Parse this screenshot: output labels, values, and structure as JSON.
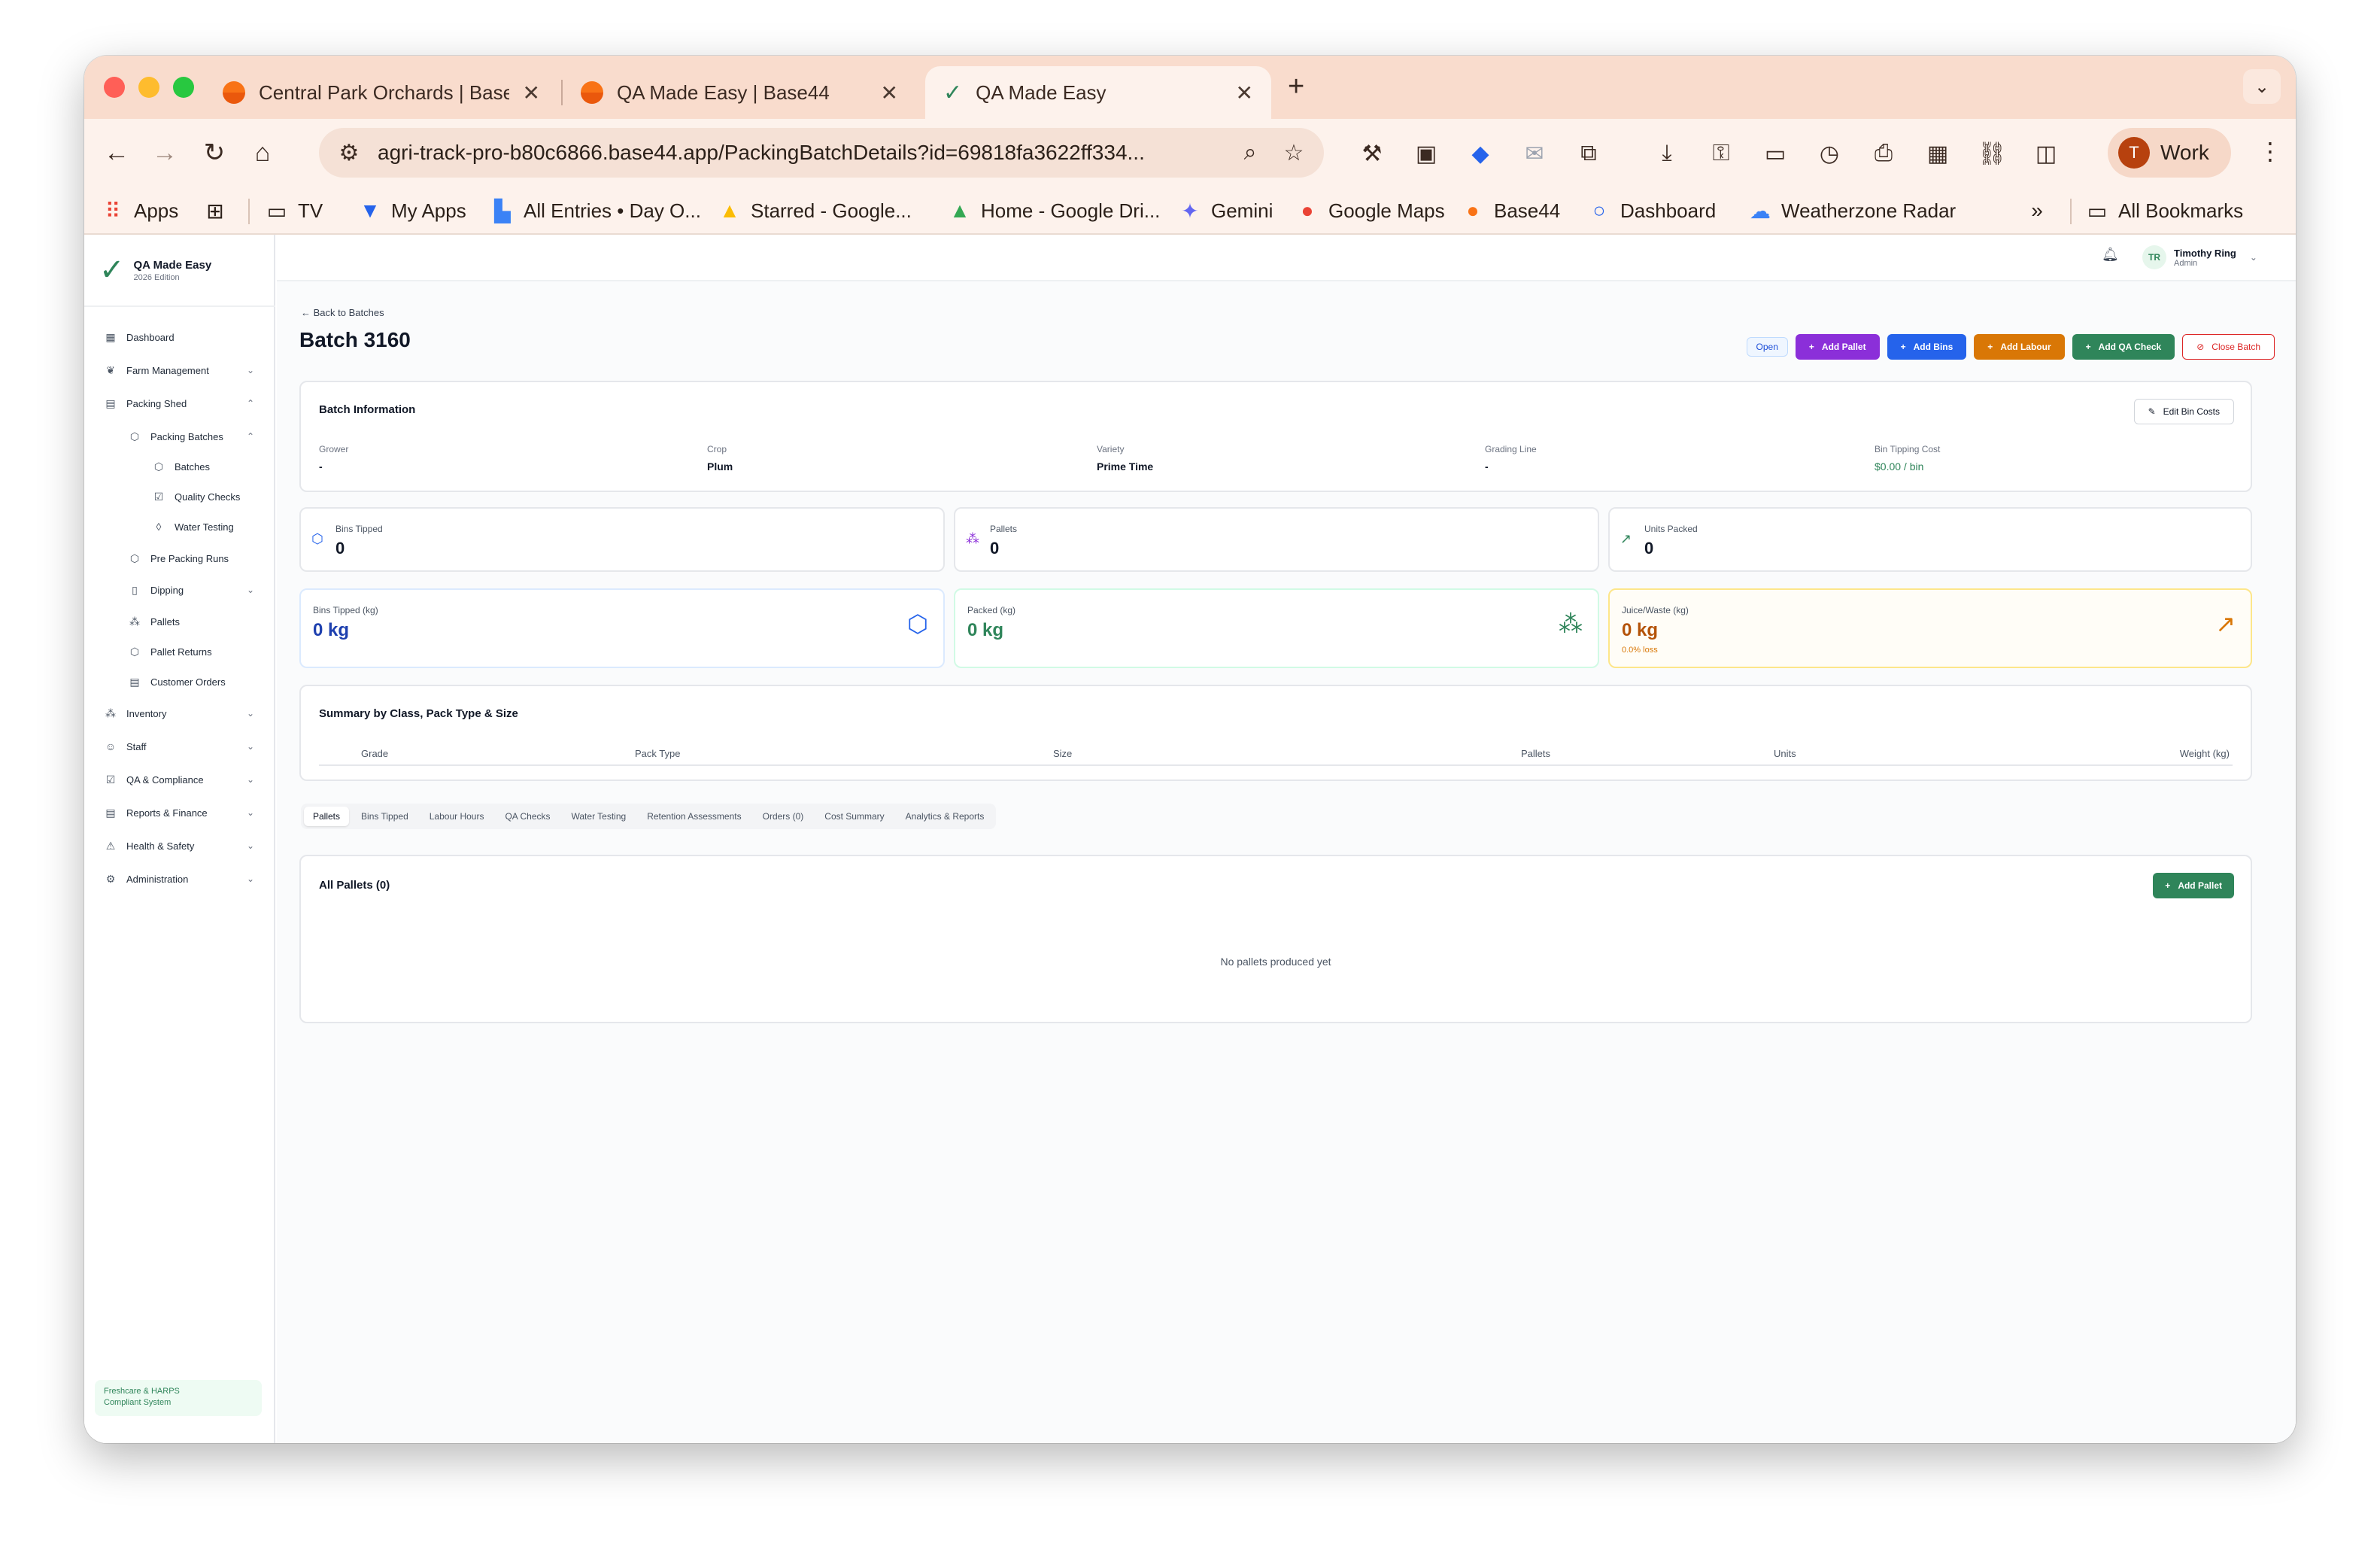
{
  "browser": {
    "tabs": [
      {
        "title": "Central Park Orchards | Base44"
      },
      {
        "title": "QA Made Easy | Base44"
      },
      {
        "title": "QA Made Easy"
      }
    ],
    "url": "agri-track-pro-b80c6866.base44.app/PackingBatchDetails?id=69818fa3622ff334...",
    "profile_initial": "T",
    "profile_label": "Work",
    "bookmarks": [
      {
        "label": "Apps"
      },
      {
        "label": "TV"
      },
      {
        "label": "My Apps"
      },
      {
        "label": "All Entries • Day O..."
      },
      {
        "label": "Starred - Google..."
      },
      {
        "label": "Home - Google Dri..."
      },
      {
        "label": "Gemini"
      },
      {
        "label": "Google Maps"
      },
      {
        "label": "Base44"
      },
      {
        "label": "Dashboard"
      },
      {
        "label": "Weatherzone Radar"
      },
      {
        "label": "All Bookmarks"
      }
    ]
  },
  "brand": {
    "name": "QA Made Easy",
    "edition": "2026 Edition"
  },
  "sidebar": {
    "items": [
      {
        "label": "Dashboard"
      },
      {
        "label": "Farm Management"
      },
      {
        "label": "Packing Shed"
      },
      {
        "label": "Packing Batches"
      },
      {
        "label": "Batches"
      },
      {
        "label": "Quality Checks"
      },
      {
        "label": "Water Testing"
      },
      {
        "label": "Pre Packing Runs"
      },
      {
        "label": "Dipping"
      },
      {
        "label": "Pallets"
      },
      {
        "label": "Pallet Returns"
      },
      {
        "label": "Customer Orders"
      },
      {
        "label": "Inventory"
      },
      {
        "label": "Staff"
      },
      {
        "label": "QA & Compliance"
      },
      {
        "label": "Reports & Finance"
      },
      {
        "label": "Health & Safety"
      },
      {
        "label": "Administration"
      }
    ],
    "footer_line1": "Freshcare & HARPS",
    "footer_line2": "Compliant System"
  },
  "user": {
    "initials": "TR",
    "name": "Timothy Ring",
    "role": "Admin"
  },
  "page": {
    "back_label": "Back to Batches",
    "title": "Batch 3160",
    "status": "Open",
    "actions": {
      "add_pallet": "Add Pallet",
      "add_bins": "Add Bins",
      "add_labour": "Add Labour",
      "add_qa_check": "Add QA Check",
      "close_batch": "Close Batch"
    }
  },
  "batch_info": {
    "title": "Batch Information",
    "edit_label": "Edit Bin Costs",
    "fields": [
      {
        "label": "Grower",
        "value": "-"
      },
      {
        "label": "Crop",
        "value": "Plum"
      },
      {
        "label": "Variety",
        "value": "Prime Time"
      },
      {
        "label": "Grading Line",
        "value": "-"
      },
      {
        "label": "Bin Tipping Cost",
        "value": "$0.00 / bin"
      }
    ]
  },
  "stats": [
    {
      "label": "Bins Tipped",
      "value": "0"
    },
    {
      "label": "Pallets",
      "value": "0"
    },
    {
      "label": "Units Packed",
      "value": "0"
    }
  ],
  "weights": [
    {
      "label": "Bins Tipped (kg)",
      "value": "0 kg"
    },
    {
      "label": "Packed (kg)",
      "value": "0 kg"
    },
    {
      "label": "Juice/Waste (kg)",
      "value": "0 kg",
      "sub": "0.0% loss"
    }
  ],
  "summary": {
    "title": "Summary by Class, Pack Type & Size",
    "columns": [
      "Grade",
      "Pack Type",
      "Size",
      "Pallets",
      "Units",
      "Weight (kg)"
    ]
  },
  "detail_tabs": [
    {
      "label": "Pallets"
    },
    {
      "label": "Bins Tipped"
    },
    {
      "label": "Labour Hours"
    },
    {
      "label": "QA Checks"
    },
    {
      "label": "Water Testing"
    },
    {
      "label": "Retention Assessments"
    },
    {
      "label": "Orders (0)"
    },
    {
      "label": "Cost Summary"
    },
    {
      "label": "Analytics & Reports"
    }
  ],
  "pallets_panel": {
    "title": "All Pallets (0)",
    "add_label": "Add Pallet",
    "empty": "No pallets produced yet"
  },
  "colors": {
    "brand_green": "#2f855a",
    "purple": "#8b2fd9",
    "blue": "#2563eb",
    "orange": "#d97706",
    "red": "#dc2626"
  }
}
